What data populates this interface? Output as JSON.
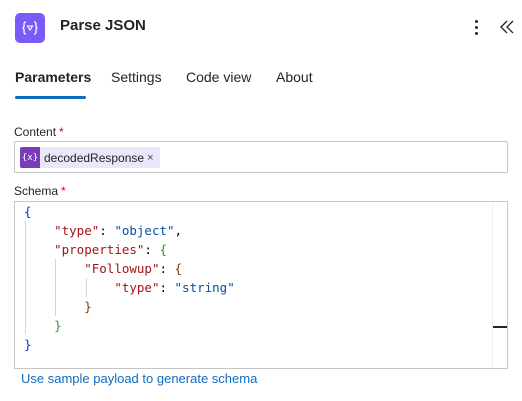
{
  "header": {
    "title": "Parse JSON",
    "icon": "braces-variable-icon",
    "accent": "#7a5af8"
  },
  "tabs": [
    {
      "label": "Parameters",
      "active": true
    },
    {
      "label": "Settings",
      "active": false
    },
    {
      "label": "Code view",
      "active": false
    },
    {
      "label": "About",
      "active": false
    }
  ],
  "content": {
    "label": "Content",
    "required_mark": "*",
    "token": {
      "icon_text": "{x}",
      "label": "decodedResponse",
      "remove": "×",
      "color": "#7a3db8"
    }
  },
  "schema": {
    "label": "Schema",
    "required_mark": "*",
    "code": {
      "l1_open": "{",
      "type_key": "\"type\"",
      "type_val": "\"object\"",
      "properties_key": "\"properties\"",
      "followup_key": "\"Followup\"",
      "inner_type_key": "\"type\"",
      "inner_type_val": "\"string\"",
      "colon": ":",
      "comma": ",",
      "open": "{",
      "close": "}"
    }
  },
  "sample_link": "Use sample payload to generate schema"
}
